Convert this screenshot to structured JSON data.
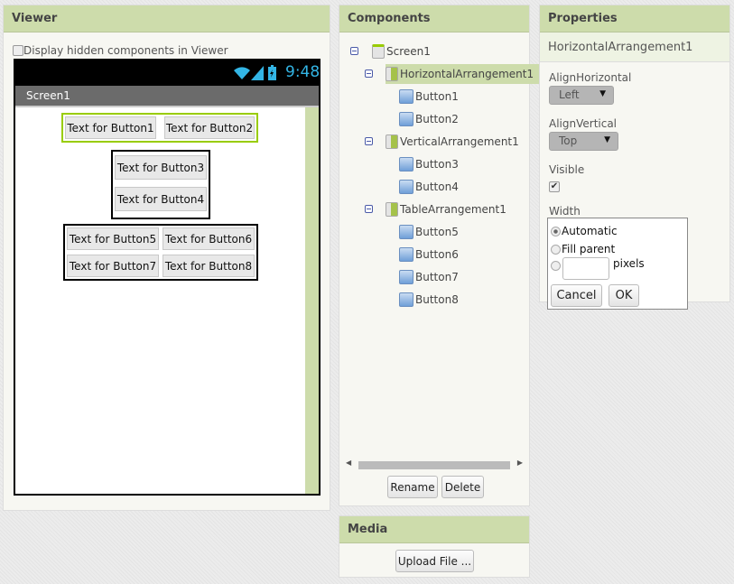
{
  "viewer": {
    "title": "Viewer",
    "hidden_checkbox_label": "Display hidden components in Viewer",
    "hidden_checked": false,
    "phone": {
      "time": "9:48",
      "screen_title": "Screen1",
      "buttons": [
        "Text for Button1",
        "Text for Button2",
        "Text for Button3",
        "Text for Button4",
        "Text for Button5",
        "Text for Button6",
        "Text for Button7",
        "Text for Button8"
      ]
    }
  },
  "components": {
    "title": "Components",
    "tree": [
      {
        "label": "Screen1",
        "level": 0,
        "icon": "screen-icon"
      },
      {
        "label": "HorizontalArrangement1",
        "level": 1,
        "icon": "horizontal-arrangement-icon",
        "selected": true
      },
      {
        "label": "Button1",
        "level": 2,
        "icon": "button-icon"
      },
      {
        "label": "Button2",
        "level": 2,
        "icon": "button-icon"
      },
      {
        "label": "VerticalArrangement1",
        "level": 1,
        "icon": "vertical-arrangement-icon"
      },
      {
        "label": "Button3",
        "level": 2,
        "icon": "button-icon"
      },
      {
        "label": "Button4",
        "level": 2,
        "icon": "button-icon"
      },
      {
        "label": "TableArrangement1",
        "level": 1,
        "icon": "table-arrangement-icon"
      },
      {
        "label": "Button5",
        "level": 2,
        "icon": "button-icon"
      },
      {
        "label": "Button6",
        "level": 2,
        "icon": "button-icon"
      },
      {
        "label": "Button7",
        "level": 2,
        "icon": "button-icon"
      },
      {
        "label": "Button8",
        "level": 2,
        "icon": "button-icon"
      }
    ],
    "rename": "Rename",
    "delete": "Delete"
  },
  "media": {
    "title": "Media",
    "upload": "Upload File ..."
  },
  "properties": {
    "title": "Properties",
    "component": "HorizontalArrangement1",
    "align_horizontal_label": "AlignHorizontal",
    "align_horizontal": "Left",
    "align_vertical_label": "AlignVertical",
    "align_vertical": "Top",
    "visible_label": "Visible",
    "visible": true,
    "width_label": "Width",
    "width_popup": {
      "automatic": "Automatic",
      "fill_parent": "Fill parent",
      "pixels": "pixels",
      "pixels_value": "",
      "selected": "Automatic",
      "cancel": "Cancel",
      "ok": "OK"
    }
  },
  "colors": {
    "header": "#cddcab",
    "selection": "#cddcab",
    "accent_border": "#99cc00",
    "status_icons": "#33b5e5"
  }
}
